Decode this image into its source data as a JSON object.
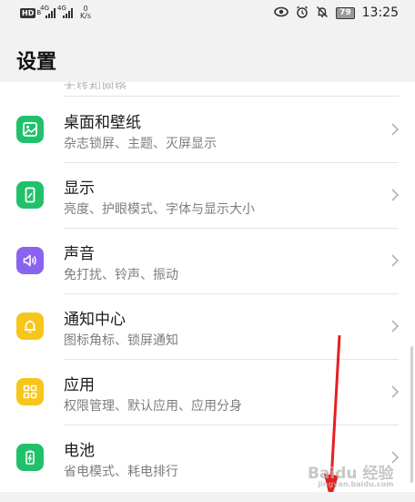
{
  "status_bar": {
    "hd_badge": "HD",
    "hd_sub": "B",
    "network_1": "4G",
    "network_2": "4G",
    "speed_value": "0",
    "speed_unit": "K/s",
    "battery": "79",
    "time": "13:25",
    "icons": [
      "eye-icon",
      "alarm-icon",
      "mute-bell-icon"
    ]
  },
  "page": {
    "title": "设置"
  },
  "clipped_previous_row": "无线和网络",
  "items": [
    {
      "title": "桌面和壁纸",
      "subtitle": "杂志锁屏、主题、灭屏显示",
      "icon": "wallpaper-icon",
      "color": "#21c16b"
    },
    {
      "title": "显示",
      "subtitle": "亮度、护眼模式、字体与显示大小",
      "icon": "display-icon",
      "color": "#21c16b"
    },
    {
      "title": "声音",
      "subtitle": "免打扰、铃声、振动",
      "icon": "sound-icon",
      "color": "#8a63f0"
    },
    {
      "title": "通知中心",
      "subtitle": "图标角标、锁屏通知",
      "icon": "bell-icon",
      "color": "#f7c61a"
    },
    {
      "title": "应用",
      "subtitle": "权限管理、默认应用、应用分身",
      "icon": "apps-icon",
      "color": "#f7c61a"
    },
    {
      "title": "电池",
      "subtitle": "省电模式、耗电排行",
      "icon": "battery-icon",
      "color": "#21c16b"
    }
  ],
  "watermark": {
    "text": "Baidu 经验",
    "sub": "jingyan.baidu.com"
  },
  "colors": {
    "arrow": "#e81e1e",
    "divider": "#e4e4e4",
    "subtitle": "#7d7d7d"
  }
}
